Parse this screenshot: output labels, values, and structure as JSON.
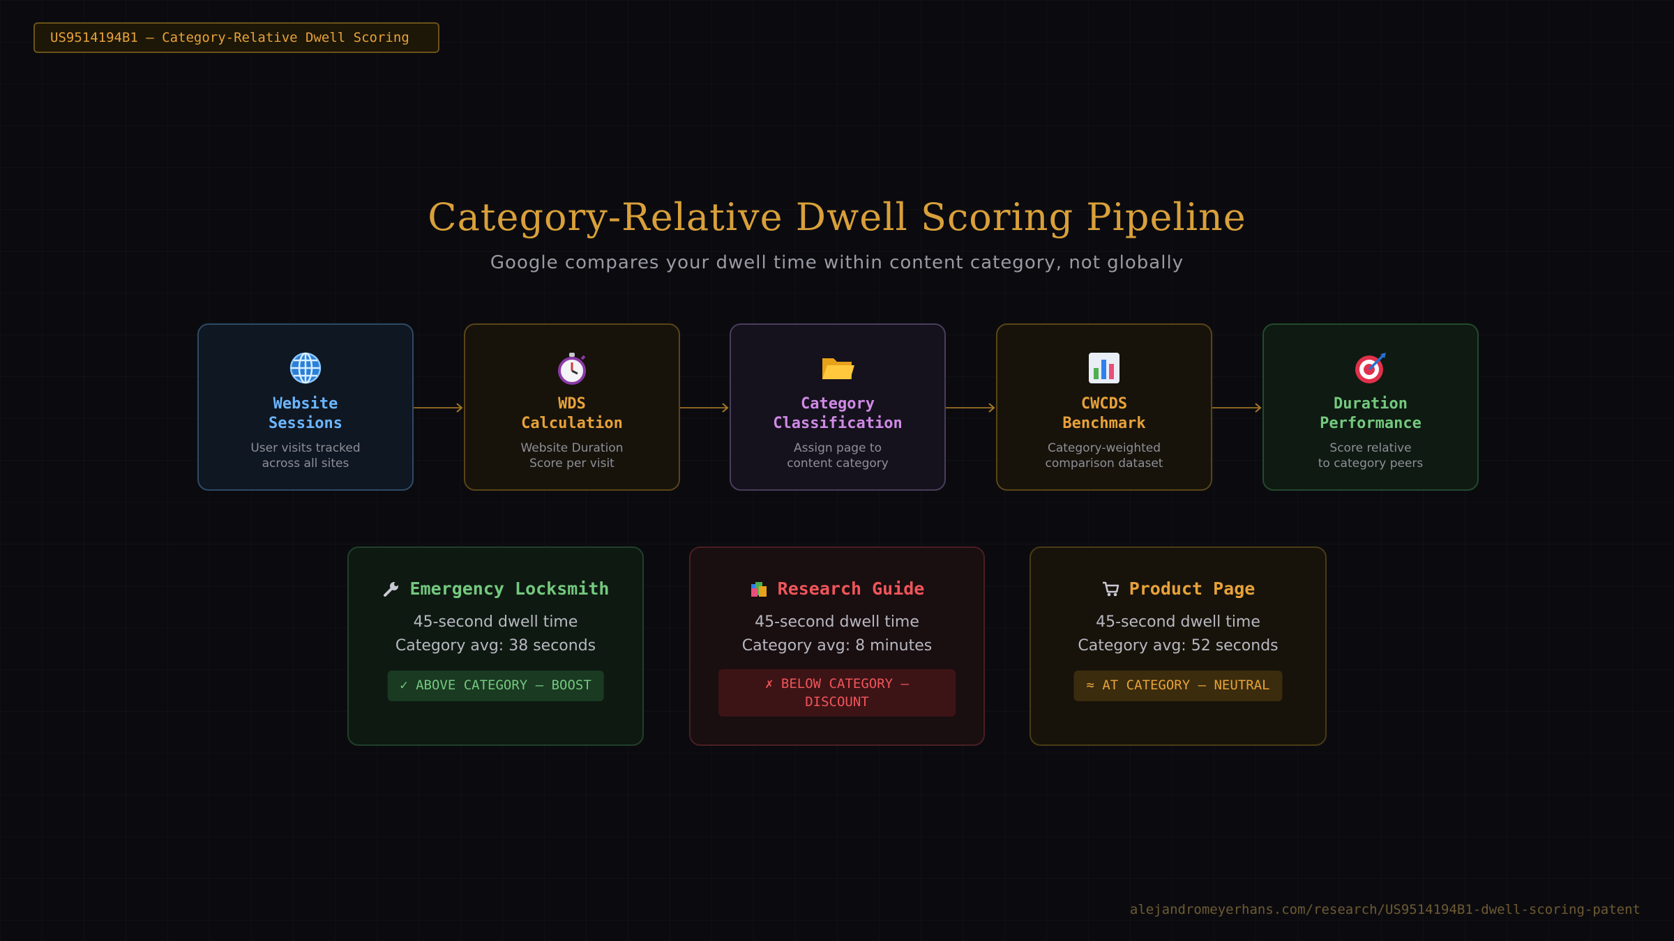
{
  "tag": "US9514194B1 — Category-Relative Dwell Scoring",
  "title": "Category-Relative Dwell Scoring Pipeline",
  "subtitle": "Google compares your dwell time within content category, not globally",
  "steps": [
    {
      "icon": "globe-icon",
      "title_1": "Website",
      "title_2": "Sessions",
      "desc_1": "User visits tracked",
      "desc_2": "across all sites",
      "color": "#6cb6ff"
    },
    {
      "icon": "stopwatch-icon",
      "title_1": "WDS",
      "title_2": "Calculation",
      "desc_1": "Website Duration",
      "desc_2": "Score per visit",
      "color": "#e8a23a"
    },
    {
      "icon": "folder-icon",
      "title_1": "Category",
      "title_2": "Classification",
      "desc_1": "Assign page to",
      "desc_2": "content category",
      "color": "#d08ae6"
    },
    {
      "icon": "bar-chart-icon",
      "title_1": "CWCDS",
      "title_2": "Benchmark",
      "desc_1": "Category-weighted",
      "desc_2": "comparison dataset",
      "color": "#e8a23a"
    },
    {
      "icon": "target-icon",
      "title_1": "Duration",
      "title_2": "Performance",
      "desc_1": "Score relative",
      "desc_2": "to category peers",
      "color": "#74c97e"
    }
  ],
  "cases": [
    {
      "icon": "wrench-icon",
      "title": "Emergency Locksmith",
      "line_1": "45-second dwell time",
      "line_2": "Category avg: 38 seconds",
      "verdict": "✓ ABOVE CATEGORY — BOOST",
      "color": "#74c97e"
    },
    {
      "icon": "books-icon",
      "title": "Research Guide",
      "line_1": "45-second dwell time",
      "line_2": "Category avg: 8 minutes",
      "verdict_1": "✗ BELOW CATEGORY —",
      "verdict_2": "DISCOUNT",
      "color": "#f0555a"
    },
    {
      "icon": "cart-icon",
      "title": "Product Page",
      "line_1": "45-second dwell time",
      "line_2": "Category avg: 52 seconds",
      "verdict": "≈ AT CATEGORY — NEUTRAL",
      "color": "#e8a23a"
    }
  ],
  "footer": "alejandromeyerhans.com/research/US9514194B1-dwell-scoring-patent"
}
